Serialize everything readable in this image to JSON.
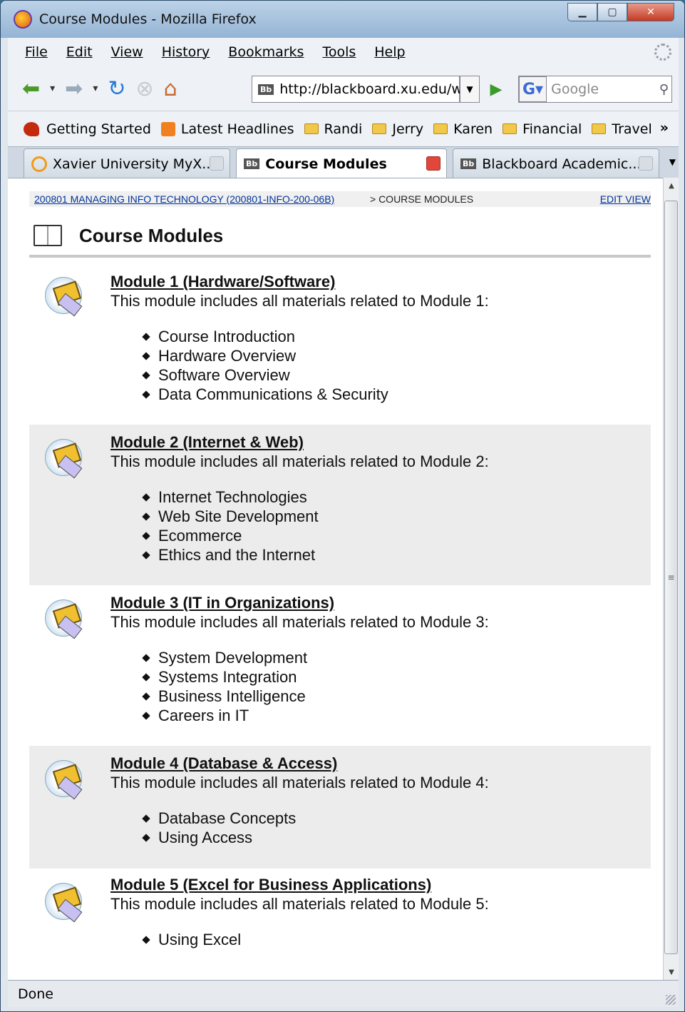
{
  "window": {
    "title": "Course Modules - Mozilla Firefox"
  },
  "menu": [
    "File",
    "Edit",
    "View",
    "History",
    "Bookmarks",
    "Tools",
    "Help"
  ],
  "nav": {
    "url": "http://blackboard.xu.edu/w",
    "search_placeholder": "Google"
  },
  "bookmarks": [
    "Getting Started",
    "Latest Headlines",
    "Randi",
    "Jerry",
    "Karen",
    "Financial",
    "Travel"
  ],
  "tabs": [
    "Xavier University MyX...",
    "Course Modules",
    "Blackboard Academic..."
  ],
  "breadcrumb": {
    "course": "200801 MANAGING INFO TECHNOLOGY (200801-INFO-200-06B)",
    "current": "> COURSE MODULES",
    "edit": "EDIT VIEW"
  },
  "page": {
    "title": "Course Modules"
  },
  "modules": [
    {
      "title": "Module 1 (Hardware/Software)",
      "desc": "This module includes all materials related to Module 1:",
      "items": [
        "Course Introduction",
        "Hardware Overview",
        "Software Overview",
        "Data Communications & Security"
      ]
    },
    {
      "title": "Module 2 (Internet & Web)",
      "desc": "This module includes all materials related to Module 2:",
      "items": [
        "Internet Technologies",
        "Web Site Development",
        "Ecommerce",
        "Ethics and the Internet"
      ]
    },
    {
      "title": "Module 3 (IT in Organizations)",
      "desc": "This module includes all materials related to Module 3:",
      "items": [
        "System Development",
        "Systems Integration",
        "Business Intelligence",
        "Careers in IT"
      ]
    },
    {
      "title": "Module 4 (Database & Access)",
      "desc": "This module includes all materials related to Module 4:",
      "items": [
        "Database Concepts",
        "Using Access"
      ]
    },
    {
      "title": "Module 5 (Excel for Business Applications)",
      "desc": "This module includes all materials related to Module 5:",
      "items": [
        "Using Excel"
      ]
    }
  ],
  "status": "Done"
}
